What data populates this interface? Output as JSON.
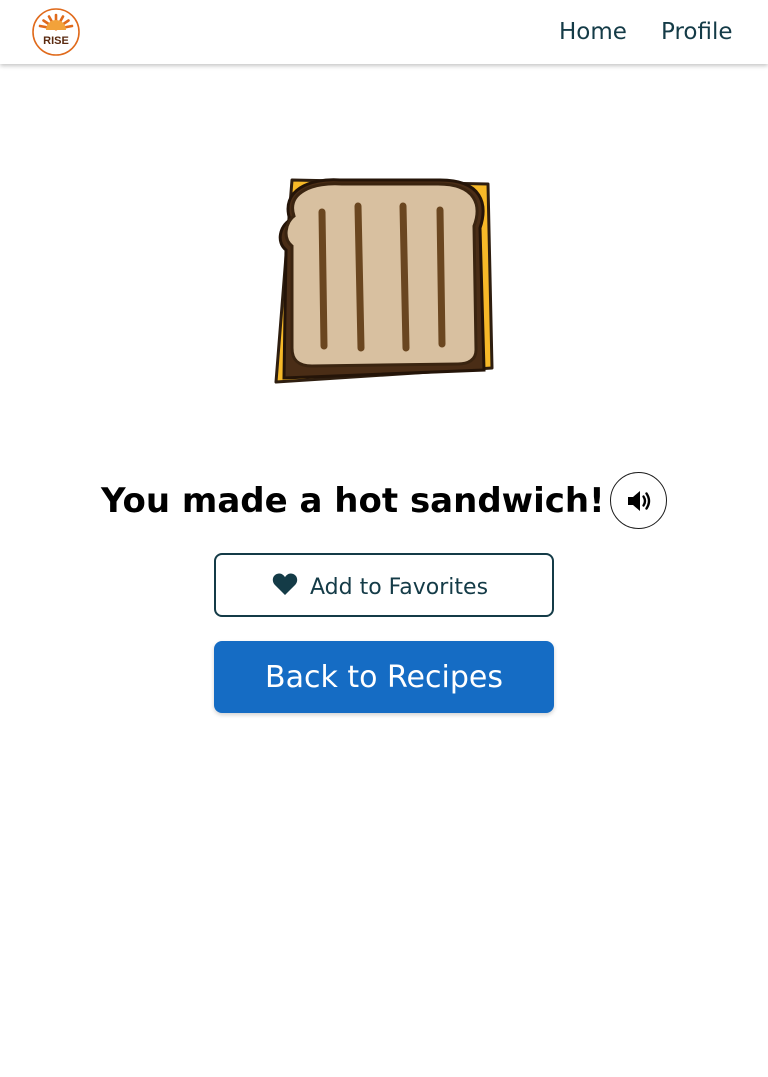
{
  "navbar": {
    "logo_text": "RISE",
    "links": [
      {
        "label": "Home"
      },
      {
        "label": "Profile"
      }
    ]
  },
  "main": {
    "image_icon": "grilled-cheese-sandwich-icon",
    "headline": "You made a hot sandwich!",
    "audio_icon": "speaker-icon",
    "favorite_button": {
      "label": "Add to Favorites",
      "icon": "heart-icon"
    },
    "back_button": {
      "label": "Back to Recipes"
    }
  },
  "colors": {
    "nav_text": "#143b47",
    "logo_orange": "#e06a1b",
    "primary_button": "#156cc4",
    "favorite_border": "#143b47",
    "cheese": "#f7b928",
    "bread": "#d8c0a0",
    "crust": "#5a3a1e"
  }
}
